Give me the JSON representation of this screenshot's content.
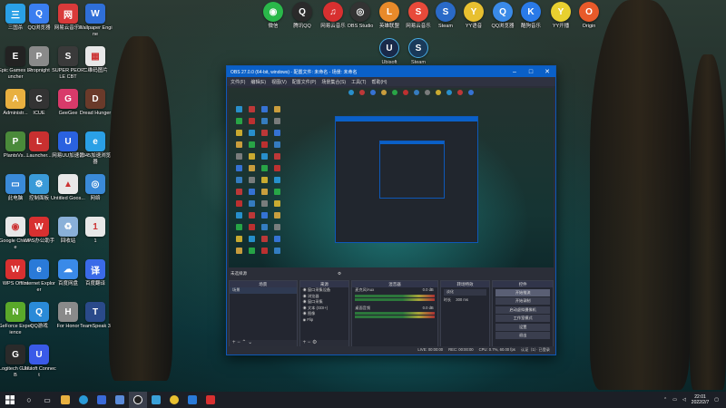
{
  "desktop": {
    "icons_left": [
      {
        "label": "三国杀",
        "color": "#2aa0e6",
        "glyph": "三"
      },
      {
        "label": "QQ浏览器",
        "color": "#3a7ef0",
        "glyph": "Q"
      },
      {
        "label": "网易云音乐2",
        "color": "#d93a3a",
        "glyph": "网"
      },
      {
        "label": "Wallpaper Engine",
        "color": "#2f6fd8",
        "glyph": "W"
      },
      {
        "label": "Epic Games Launcher",
        "color": "#222222",
        "glyph": "E"
      },
      {
        "label": "Propnight",
        "color": "#8a8a8a",
        "glyph": "P"
      },
      {
        "label": "SUPER PEOPLE CBT",
        "color": "#3a3a3a",
        "glyph": "S"
      },
      {
        "label": "二维码图片",
        "color": "#e8e8e8",
        "glyph": "▦"
      },
      {
        "label": "Administr...",
        "color": "#e8b040",
        "glyph": "A"
      },
      {
        "label": "ICUE",
        "color": "#333333",
        "glyph": "C"
      },
      {
        "label": "GeeGee",
        "color": "#d83a6a",
        "glyph": "G"
      },
      {
        "label": "Dread Hunger",
        "color": "#6a3a2a",
        "glyph": "D"
      },
      {
        "label": "PlantsVs...",
        "color": "#4a8a3a",
        "glyph": "P"
      },
      {
        "label": "Launcher...",
        "color": "#c83030",
        "glyph": "L"
      },
      {
        "label": "网易UU加速器",
        "color": "#2a62e0",
        "glyph": "U"
      },
      {
        "label": "2345加速浏览器",
        "color": "#2aa0e6",
        "glyph": "e"
      },
      {
        "label": "此电脑",
        "color": "#3a8ad8",
        "glyph": "▭"
      },
      {
        "label": "控制面板",
        "color": "#3a9ad8",
        "glyph": "⚙"
      },
      {
        "label": "Untitled Goos...",
        "color": "#e8e8e8",
        "glyph": "▲"
      },
      {
        "label": "网络",
        "color": "#3a8ad8",
        "glyph": "◎"
      },
      {
        "label": "Google Chrome",
        "color": "#e8e8e8",
        "glyph": "◉"
      },
      {
        "label": "WPS办公助手",
        "color": "#d83030",
        "glyph": "W"
      },
      {
        "label": "回收站",
        "color": "#8ab0d8",
        "glyph": "♻"
      },
      {
        "label": "1",
        "color": "#e8e8e8",
        "glyph": "1"
      },
      {
        "label": "WPS Office",
        "color": "#d83030",
        "glyph": "W"
      },
      {
        "label": "Internet Explorer",
        "color": "#2a7ad8",
        "glyph": "e"
      },
      {
        "label": "百度网盘",
        "color": "#3a8ae8",
        "glyph": "☁"
      },
      {
        "label": "百度翻译",
        "color": "#3a6ae8",
        "glyph": "译"
      },
      {
        "label": "GeForce Experience",
        "color": "#5aa82a",
        "glyph": "N"
      },
      {
        "label": "QQ游戏",
        "color": "#2a8ad8",
        "glyph": "Q"
      },
      {
        "label": "For Honor",
        "color": "#8a8a8a",
        "glyph": "H"
      },
      {
        "label": "TeamSpeak 3",
        "color": "#2a4a8a",
        "glyph": "T"
      },
      {
        "label": "Logitech G HUB",
        "color": "#2a2a2a",
        "glyph": "G"
      },
      {
        "label": "Ubisoft Connect",
        "color": "#3a5ae8",
        "glyph": "U"
      }
    ],
    "icons_top": [
      {
        "label": "微信",
        "color": "#2ab84a",
        "glyph": "◉"
      },
      {
        "label": "腾讯QQ",
        "color": "#2a2a2a",
        "glyph": "Q"
      },
      {
        "label": "网易云音乐",
        "color": "#d83030",
        "glyph": "♫"
      },
      {
        "label": "OBS Studio",
        "color": "#333333",
        "glyph": "◎"
      },
      {
        "label": "英雄联盟",
        "color": "#e88a2a",
        "glyph": "L"
      },
      {
        "label": "网易云音乐",
        "color": "#e84a3a",
        "glyph": "S"
      },
      {
        "label": "Steam",
        "color": "#2a6ac8",
        "glyph": "S"
      },
      {
        "label": "YY语音",
        "color": "#e8c030",
        "glyph": "Y"
      },
      {
        "label": "QQ浏览器",
        "color": "#3a8ae8",
        "glyph": "Q"
      },
      {
        "label": "酷狗音乐",
        "color": "#2a7ae8",
        "glyph": "K"
      },
      {
        "label": "YY开播",
        "color": "#e8d030",
        "glyph": "Y"
      },
      {
        "label": "Origin",
        "color": "#e85a2a",
        "glyph": "O"
      }
    ],
    "icons_top2": [
      {
        "label": "Ubisoft",
        "color": "#1a2a4a",
        "glyph": "U"
      },
      {
        "label": "Steam",
        "color": "#1a3a5a",
        "glyph": "S"
      }
    ]
  },
  "obs": {
    "title": "OBS 27.0.0 (64-bit, windows) - 配置文件: 未命名 - 场景: 未命名",
    "menu": [
      "文件(F)",
      "编辑(E)",
      "视图(V)",
      "配置文件(P)",
      "场景集合(S)",
      "工具(T)",
      "帮助(H)"
    ],
    "below_bar": "未选择源",
    "docks": {
      "scenes": {
        "header": "场景",
        "items": [
          "场景"
        ]
      },
      "sources": {
        "header": "来源",
        "items": [
          "窗口采集设备",
          "浏览器",
          "窗口采集",
          "文本 (GDI+)",
          "图像",
          "Flip"
        ]
      },
      "mixer": {
        "header": "混音器",
        "channels": [
          {
            "name": "麦克风/Aux",
            "db": "0.0 dB"
          },
          {
            "name": "桌面音频",
            "db": "0.0 dB"
          }
        ]
      },
      "transitions": {
        "header": "转场特效",
        "type": "淡化",
        "duration_label": "时长",
        "duration": "300 ms"
      },
      "controls": {
        "header": "控件",
        "buttons": [
          "开始推流",
          "开始录制",
          "启动虚拟摄像机",
          "工作室模式",
          "设置",
          "退出"
        ]
      }
    },
    "status": [
      "LIVE: 00:00:00",
      "REC: 00:00:00",
      "CPU: 0.7%, 60.00 fps"
    ],
    "corner_text": "认证（1）· 已登录"
  },
  "taskbar": {
    "time": "22:01",
    "date": "2022/2/7"
  }
}
